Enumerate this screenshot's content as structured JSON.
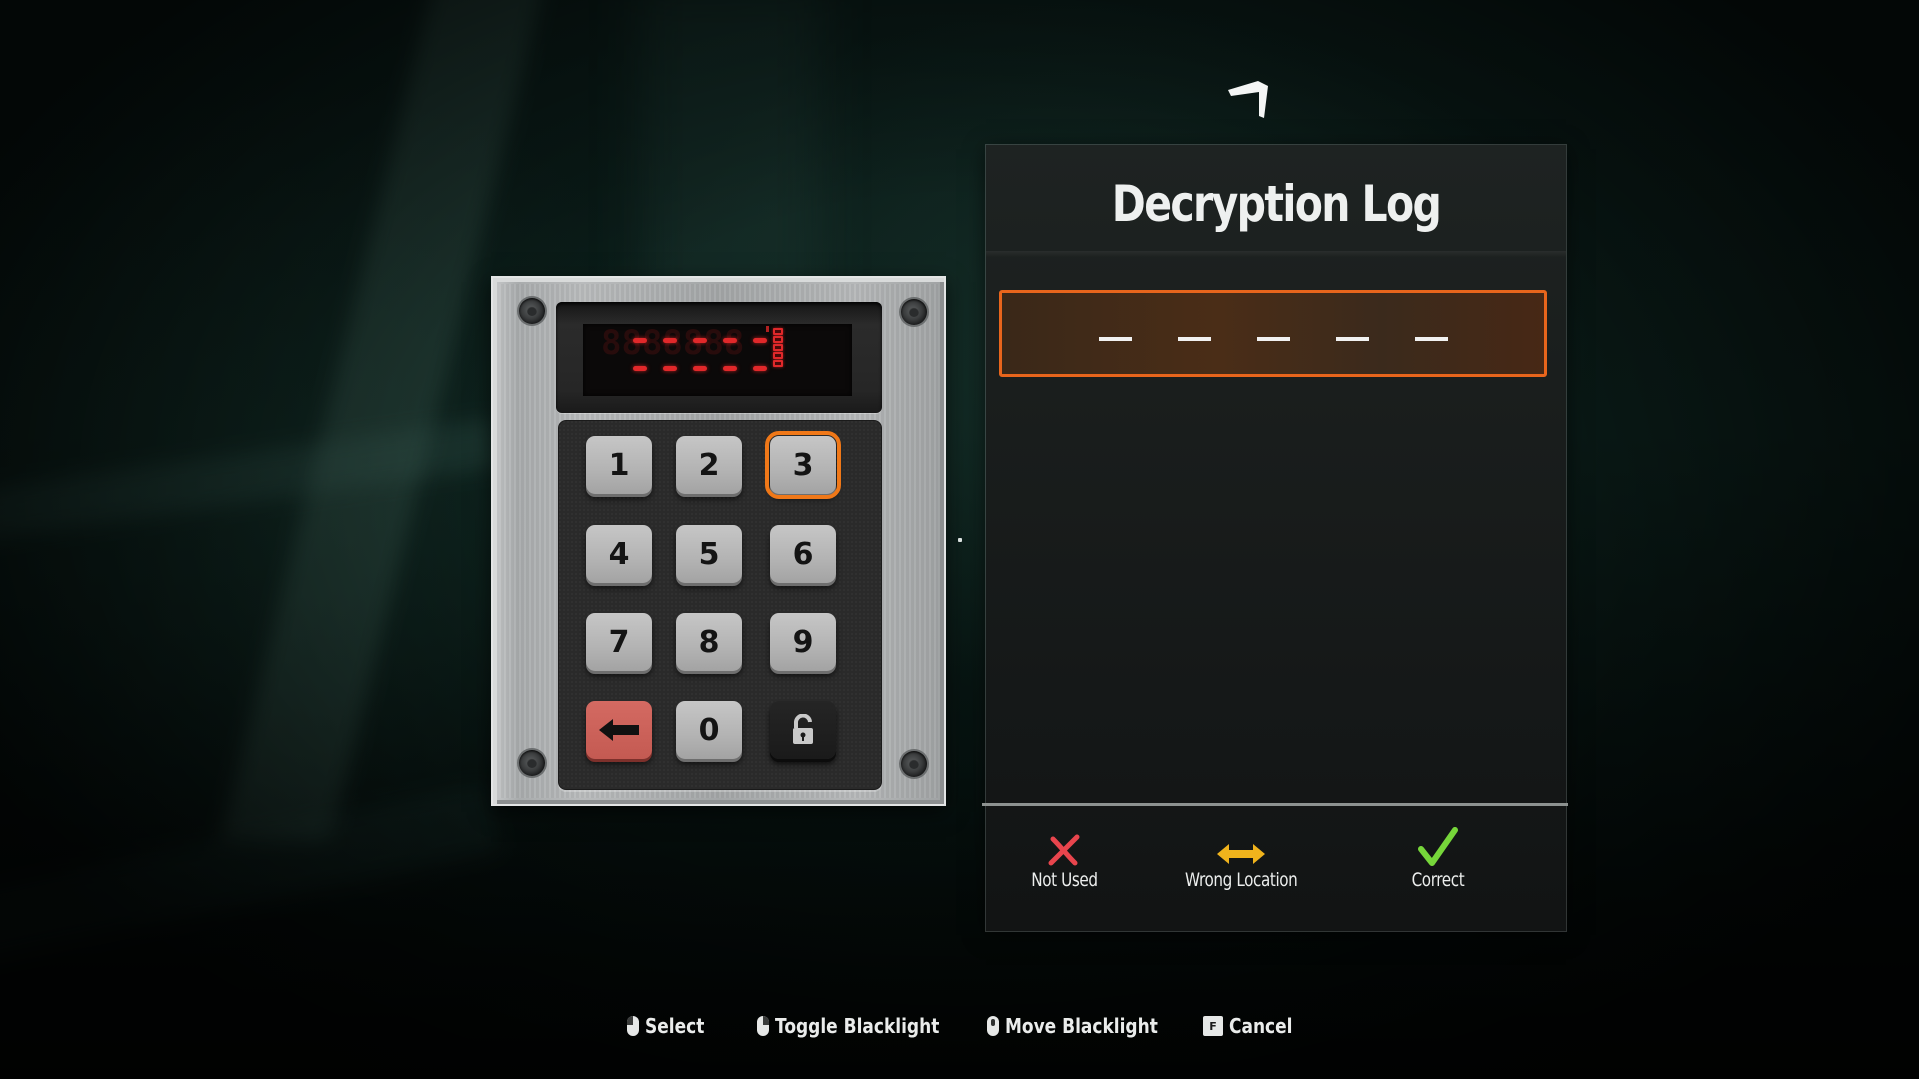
{
  "keypad": {
    "display": {
      "row1_dashes": 5,
      "row2_dashes": 5,
      "ghost_digits": "8888888",
      "attempt_indicators": 5
    },
    "keys": [
      {
        "label": "1",
        "type": "digit",
        "selected": false
      },
      {
        "label": "2",
        "type": "digit",
        "selected": false
      },
      {
        "label": "3",
        "type": "digit",
        "selected": true
      },
      {
        "label": "4",
        "type": "digit",
        "selected": false
      },
      {
        "label": "5",
        "type": "digit",
        "selected": false
      },
      {
        "label": "6",
        "type": "digit",
        "selected": false
      },
      {
        "label": "7",
        "type": "digit",
        "selected": false
      },
      {
        "label": "8",
        "type": "digit",
        "selected": false
      },
      {
        "label": "9",
        "type": "digit",
        "selected": false
      },
      {
        "label": "",
        "type": "backspace",
        "icon": "arrow-left-icon",
        "selected": false
      },
      {
        "label": "0",
        "type": "digit",
        "selected": false
      },
      {
        "label": "",
        "type": "unlock",
        "icon": "unlock-icon",
        "selected": false
      }
    ],
    "colors": {
      "highlight": "#f07818",
      "backspace": "#c95f57",
      "led": "#e0282a"
    }
  },
  "log": {
    "title": "Decryption Log",
    "code_slots": [
      "",
      "",
      "",
      "",
      ""
    ],
    "entries": [],
    "legend": [
      {
        "icon": "x-icon",
        "label": "Not Used",
        "color": "#e8454d"
      },
      {
        "icon": "double-arrow-icon",
        "label": "Wrong Location",
        "color": "#f0b31c"
      },
      {
        "icon": "check-icon",
        "label": "Correct",
        "color": "#76d63a"
      }
    ],
    "accent": "#e8651c"
  },
  "hints": [
    {
      "icon": "mouse-left-click-icon",
      "label": "Select"
    },
    {
      "icon": "mouse-right-click-icon",
      "label": "Toggle Blacklight"
    },
    {
      "icon": "mouse-move-icon",
      "label": "Move Blacklight"
    },
    {
      "icon": "key-f-icon",
      "key": "F",
      "label": "Cancel"
    }
  ]
}
